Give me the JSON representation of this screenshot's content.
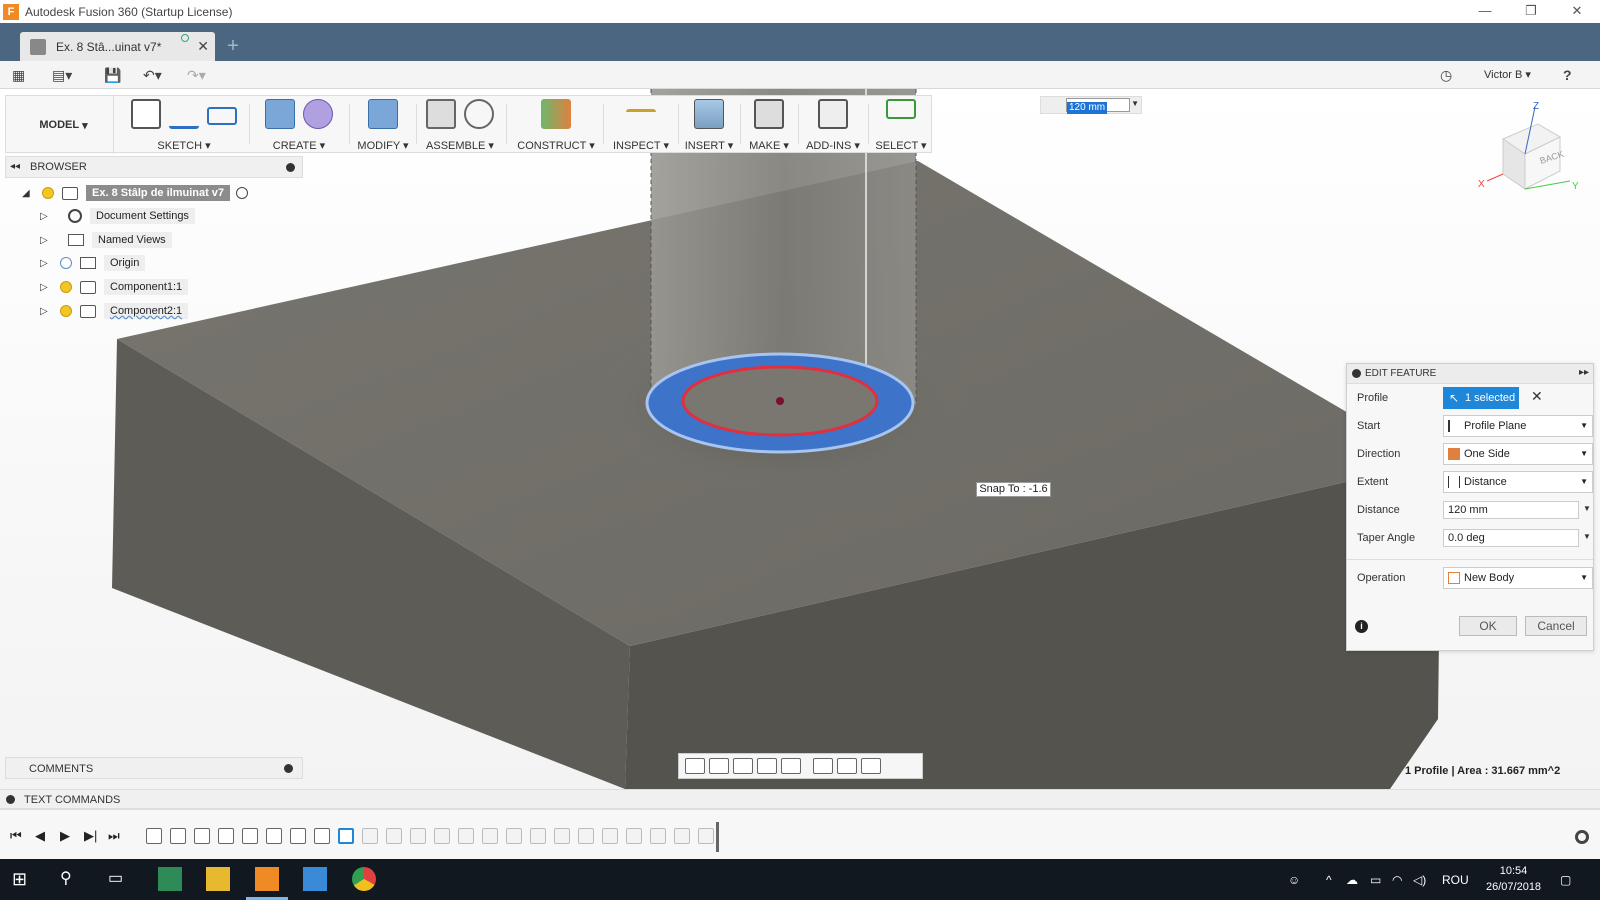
{
  "window": {
    "title": "Autodesk Fusion 360 (Startup License)",
    "app_logo": "F"
  },
  "tab": {
    "label": "Ex. 8 Stâ...uinat v7*",
    "close": "✕",
    "new": "+"
  },
  "qat": {
    "user": "Victor B ▾",
    "help": "?"
  },
  "toolbar": {
    "workspace": "MODEL",
    "groups": [
      "SKETCH",
      "CREATE",
      "MODIFY",
      "ASSEMBLE",
      "CONSTRUCT",
      "INSPECT",
      "INSERT",
      "MAKE",
      "ADD-INS",
      "SELECT"
    ]
  },
  "distance_input": {
    "value": "120 mm"
  },
  "browser": {
    "title": "BROWSER",
    "root": "Ex. 8 Stâlp de ilmuinat v7",
    "items": [
      "Document Settings",
      "Named Views",
      "Origin",
      "Component1:1",
      "Component2:1"
    ]
  },
  "edit_feature": {
    "title": "EDIT FEATURE",
    "rows": [
      {
        "label": "Profile",
        "value": "1 selected"
      },
      {
        "label": "Start",
        "value": "Profile Plane"
      },
      {
        "label": "Direction",
        "value": "One Side"
      },
      {
        "label": "Extent",
        "value": "Distance"
      },
      {
        "label": "Distance",
        "value": "120 mm"
      },
      {
        "label": "Taper Angle",
        "value": "0.0 deg"
      },
      {
        "label": "Operation",
        "value": "New Body"
      }
    ],
    "ok": "OK",
    "cancel": "Cancel"
  },
  "snap_tooltip": "Snap To : -1.6",
  "comments": "COMMENTS",
  "status": "1 Profile | Area : 31.667 mm^2",
  "text_commands": "TEXT COMMANDS",
  "viewcube": {
    "face": "BACK",
    "axis_x": "X",
    "axis_y": "Y",
    "axis_z": "Z"
  },
  "taskbar": {
    "time": "10:54",
    "date": "26/07/2018",
    "lang": "ROU"
  },
  "colors": {
    "tabbar": "#4b6680",
    "accent": "#1e87d9",
    "solid": "#6f6d67",
    "taskbar": "#111820"
  }
}
